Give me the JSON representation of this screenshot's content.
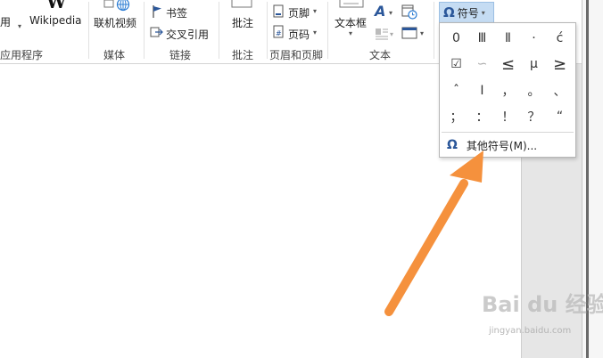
{
  "ribbon": {
    "apps_fragment_top": "用",
    "apps_group_label": "应用程序",
    "wikipedia_icon": "W",
    "wikipedia_label": "Wikipedia",
    "media": {
      "online_video_label": "联机视频",
      "group_label": "媒体"
    },
    "links": {
      "bookmark_label": "书签",
      "cross_reference_label": "交叉引用",
      "group_label": "链接"
    },
    "comments": {
      "comment_label": "批注",
      "group_label": "批注"
    },
    "header_footer": {
      "footer_label": "页脚",
      "page_number_label": "页码",
      "group_label": "页眉和页脚"
    },
    "text": {
      "textbox_label": "文本框",
      "group_label": "文本"
    },
    "symbols": {
      "symbol_button_label": "符号"
    }
  },
  "symbol_dropdown": {
    "symbols": [
      "0",
      "Ⅲ",
      "Ⅱ",
      "·",
      "ć",
      "☑",
      "∽",
      "≤",
      "μ",
      "≥",
      "ˆ",
      "Ⅰ",
      "，",
      "。",
      "、",
      "；",
      "：",
      "！",
      "？",
      "“"
    ],
    "more_symbols_label": "其他符号(M)..."
  },
  "watermark": {
    "brand": "Bai du 经验",
    "url": "jingyan.baidu.com"
  },
  "colors": {
    "arrow": "#f5913d",
    "symbol_button_bg": "#c5dcf3",
    "accent_blue": "#2b579a"
  }
}
